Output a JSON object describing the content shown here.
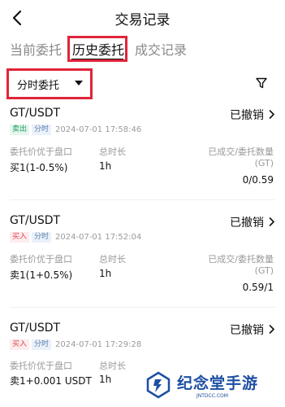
{
  "header": {
    "title": "交易记录"
  },
  "tabs": [
    {
      "label": "当前委托"
    },
    {
      "label": "历史委托"
    },
    {
      "label": "成交记录"
    }
  ],
  "filter": {
    "selected": "分时委托"
  },
  "labels": {
    "price_condition": "委托价优于盘口",
    "duration": "总时长",
    "filled_total": "已成交/委托数量",
    "unit": "(GT)"
  },
  "orders": [
    {
      "pair": "GT/USDT",
      "status": "已撤销",
      "side": "卖出",
      "type": "分时",
      "time": "2024-07-01 17:58:46",
      "price_condition": "买1(1-0.5%)",
      "duration": "1h",
      "filled": "0/0.59"
    },
    {
      "pair": "GT/USDT",
      "status": "已撤销",
      "side": "买入",
      "type": "分时",
      "time": "2024-07-01 17:52:04",
      "price_condition": "卖1(1+0.5%)",
      "duration": "1h",
      "filled": "0.59/1"
    },
    {
      "pair": "GT/USDT",
      "status": "已撤销",
      "side": "买入",
      "type": "分时",
      "time": "2024-07-01 17:29:28",
      "price_condition": "卖1+0.001 USDT",
      "duration": "1h",
      "filled": ""
    }
  ],
  "watermark": {
    "brand": "纪念堂手游",
    "site": "JNTDCC.COM"
  },
  "colors": {
    "highlight": "#e0243a",
    "sell": "#1f9a5d",
    "buy": "#e0454e",
    "brand": "#1d4fa3"
  }
}
